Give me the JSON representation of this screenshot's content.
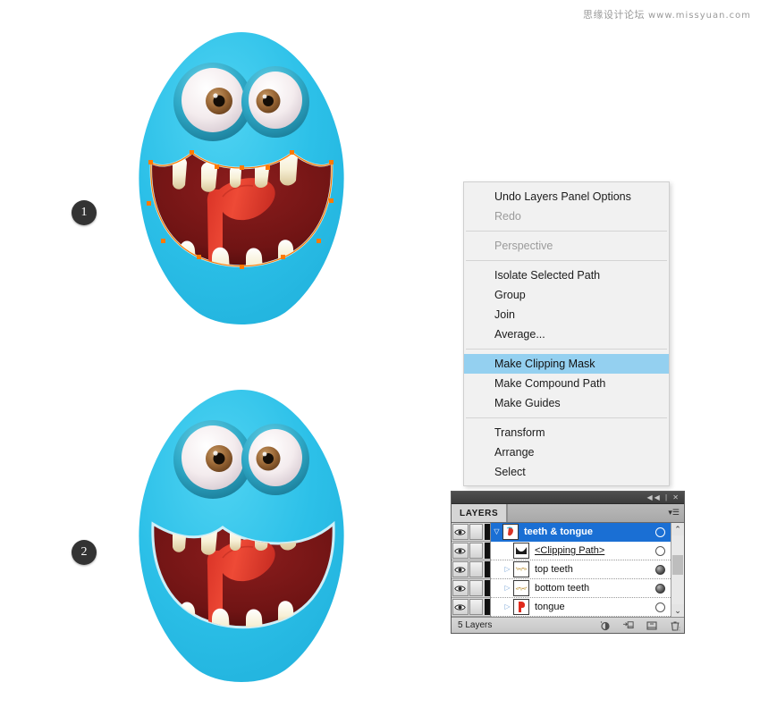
{
  "watermark": {
    "forum": "思缘设计论坛",
    "url": "www.missyuan.com"
  },
  "steps": [
    {
      "number": "1"
    },
    {
      "number": "2"
    }
  ],
  "illustrations": [
    {
      "name": "monster-with-selected-mouth-path",
      "body_color": "#2fbfe8",
      "mouth_color": "#7a1616",
      "tongue_color": "#e03a2a",
      "teeth_color": "#f6efd4",
      "path_stroke": "#ff7a00",
      "anchor_color": "#ff7a00",
      "state": "mouth path selected"
    },
    {
      "name": "monster-with-clipping-mask-applied",
      "body_color": "#2fbfe8",
      "mouth_color": "#7a1616",
      "tongue_color": "#e03a2a",
      "teeth_color": "#f6efd4",
      "state": "clipping mask applied"
    }
  ],
  "context_menu": {
    "highlight_color": "#94d0f0",
    "groups": [
      [
        {
          "label": "Undo Layers Panel Options",
          "disabled": false,
          "submenu": false
        },
        {
          "label": "Redo",
          "disabled": true,
          "submenu": false
        }
      ],
      [
        {
          "label": "Perspective",
          "disabled": true,
          "submenu": true
        }
      ],
      [
        {
          "label": "Isolate Selected Path",
          "disabled": false,
          "submenu": false
        },
        {
          "label": "Group",
          "disabled": false,
          "submenu": false
        },
        {
          "label": "Join",
          "disabled": false,
          "submenu": false
        },
        {
          "label": "Average...",
          "disabled": false,
          "submenu": false
        }
      ],
      [
        {
          "label": "Make Clipping Mask",
          "disabled": false,
          "submenu": false,
          "selected": true
        },
        {
          "label": "Make Compound Path",
          "disabled": false,
          "submenu": false
        },
        {
          "label": "Make Guides",
          "disabled": false,
          "submenu": false
        }
      ],
      [
        {
          "label": "Transform",
          "disabled": false,
          "submenu": true
        },
        {
          "label": "Arrange",
          "disabled": false,
          "submenu": true
        },
        {
          "label": "Select",
          "disabled": false,
          "submenu": true
        }
      ]
    ]
  },
  "layers_panel": {
    "tab_label": "LAYERS",
    "titlebar_buttons": "◀◀ | ✕",
    "rows": [
      {
        "name": "teeth & tongue",
        "selected": true,
        "bold": true,
        "underline": false,
        "triangle": "open",
        "indent": 0,
        "thumb": "tongue-art-thumb",
        "target": "empty",
        "visible": true,
        "locked": false
      },
      {
        "name": "<Clipping Path>",
        "selected": false,
        "bold": false,
        "underline": true,
        "triangle": "none",
        "indent": 1,
        "thumb": "clipping-path-thumb",
        "target": "empty",
        "visible": true,
        "locked": false
      },
      {
        "name": "top teeth",
        "selected": false,
        "bold": false,
        "underline": false,
        "triangle": "closed",
        "indent": 1,
        "thumb": "top-teeth-thumb",
        "target": "filled",
        "visible": true,
        "locked": false
      },
      {
        "name": "bottom teeth",
        "selected": false,
        "bold": false,
        "underline": false,
        "triangle": "closed",
        "indent": 1,
        "thumb": "bottom-teeth-thumb",
        "target": "filled",
        "visible": true,
        "locked": false
      },
      {
        "name": "tongue",
        "selected": false,
        "bold": false,
        "underline": false,
        "triangle": "closed",
        "indent": 1,
        "thumb": "tongue-thumb",
        "target": "empty",
        "visible": true,
        "locked": false
      }
    ],
    "footer": {
      "count_label": "5 Layers",
      "icons": [
        "make-clipping-mask-icon",
        "create-new-sublayer-icon",
        "create-new-layer-icon",
        "delete-selection-icon"
      ]
    },
    "scrollbar": {
      "up_arrow": "⌃",
      "down_arrow": "⌄"
    }
  }
}
